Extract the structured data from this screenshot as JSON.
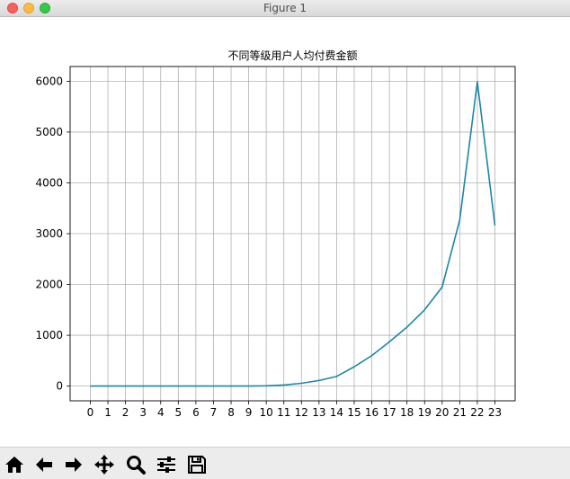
{
  "window": {
    "title": "Figure 1"
  },
  "toolbar": {
    "items": [
      {
        "name": "home-button",
        "icon": "home-icon"
      },
      {
        "name": "back-button",
        "icon": "arrow-left-icon"
      },
      {
        "name": "forward-button",
        "icon": "arrow-right-icon"
      },
      {
        "name": "pan-button",
        "icon": "move-icon"
      },
      {
        "name": "zoom-button",
        "icon": "magnifier-icon"
      },
      {
        "name": "configure-subplots-button",
        "icon": "sliders-icon"
      },
      {
        "name": "save-button",
        "icon": "floppy-disk-icon"
      }
    ]
  },
  "chart_data": {
    "type": "line",
    "title": "不同等级用户人均付费金额",
    "xlabel": "",
    "ylabel": "",
    "x": [
      0,
      1,
      2,
      3,
      4,
      5,
      6,
      7,
      8,
      9,
      10,
      11,
      12,
      13,
      14,
      15,
      16,
      17,
      18,
      19,
      20,
      21,
      22,
      23
    ],
    "series": [
      {
        "values": [
          0,
          0,
          0,
          0,
          0,
          0,
          0,
          0,
          0,
          0,
          5,
          20,
          55,
          110,
          190,
          380,
          600,
          870,
          1160,
          1500,
          1950,
          3270,
          5990,
          3160
        ],
        "color": "#1a86a8"
      }
    ],
    "xticks": [
      "0",
      "1",
      "2",
      "3",
      "4",
      "5",
      "6",
      "7",
      "8",
      "9",
      "10",
      "11",
      "12",
      "13",
      "14",
      "15",
      "16",
      "17",
      "18",
      "19",
      "20",
      "21",
      "22",
      "23"
    ],
    "yticks": [
      "0",
      "1000",
      "2000",
      "3000",
      "4000",
      "5000",
      "6000"
    ],
    "ytick_values": [
      0,
      1000,
      2000,
      3000,
      4000,
      5000,
      6000
    ],
    "xlim": [
      -1.15,
      24.15
    ],
    "ylim": [
      -290,
      6290
    ],
    "grid": true,
    "colors": {
      "grid": "#b0b0b0",
      "axes": "#000000",
      "line": "#1a86a8"
    }
  }
}
